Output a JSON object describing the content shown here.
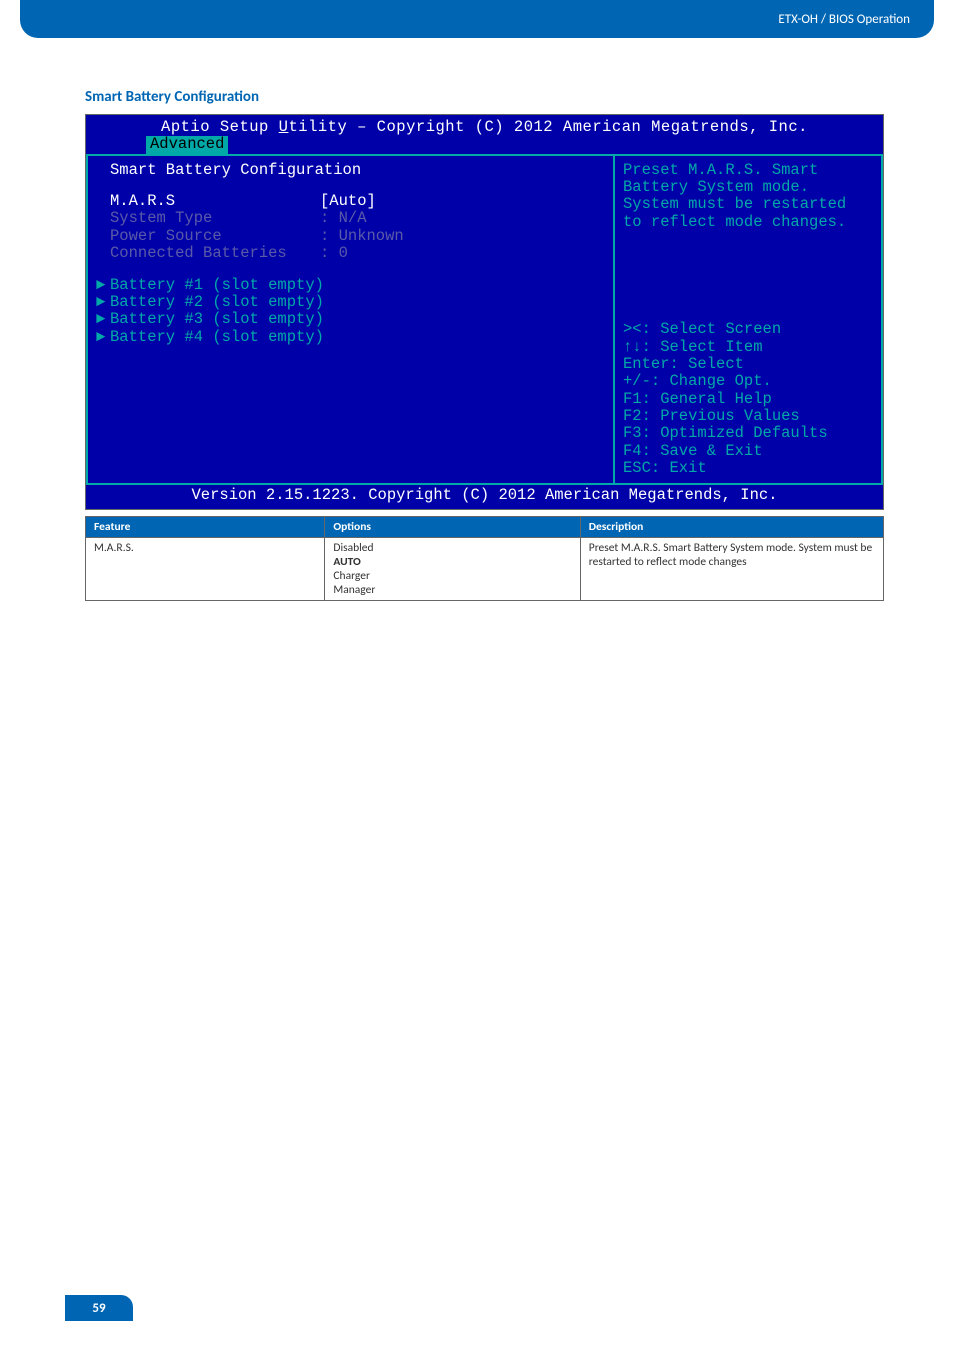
{
  "header": {
    "breadcrumb": "ETX-OH / BIOS Operation"
  },
  "section": {
    "title": "Smart Battery Configuration"
  },
  "bios": {
    "title_prefix": "Aptio Setup ",
    "title_underlined": "U",
    "title_rest": "tility – Copyright (C) 2012 American Megatrends, Inc.",
    "tab": " Advanced ",
    "heading": "Smart Battery Configuration",
    "items": [
      {
        "label": "M.A.R.S",
        "value": "[Auto]",
        "selected": true
      },
      {
        "label": "System Type",
        "value": ": N/A",
        "selected": false
      },
      {
        "label": "Power Source",
        "value": ": Unknown",
        "selected": false
      },
      {
        "label": "Connected Batteries",
        "value": ": 0",
        "selected": false
      }
    ],
    "submenus": [
      "Battery #1 (slot empty)",
      "Battery #2 (slot empty)",
      "Battery #3 (slot empty)",
      "Battery #4 (slot empty)"
    ],
    "help_text": "Preset M.A.R.S. Smart Battery System mode. System must be restarted to reflect mode changes.",
    "nav": [
      "><: Select Screen",
      "↑↓: Select Item",
      "Enter: Select",
      "+/-: Change Opt.",
      "F1: General Help",
      "F2: Previous Values",
      "F3: Optimized Defaults",
      "F4: Save & Exit",
      "ESC: Exit"
    ],
    "footer": "Version 2.15.1223. Copyright (C) 2012 American Megatrends, Inc."
  },
  "table": {
    "headers": {
      "feature": "Feature",
      "options": "Options",
      "description": "Description"
    },
    "row": {
      "feature": "M.A.R.S.",
      "options": [
        "Disabled",
        "AUTO",
        "Charger",
        "Manager"
      ],
      "default_index": 1,
      "description": "Preset M.A.R.S. Smart Battery System mode. System must be restarted to reflect mode changes"
    }
  },
  "page_number": "59",
  "chart_data": {
    "type": "table",
    "title": "Smart Battery Configuration – M.A.R.S. options",
    "columns": [
      "Feature",
      "Options",
      "Description"
    ],
    "rows": [
      [
        "M.A.R.S.",
        "Disabled | AUTO (default) | Charger | Manager",
        "Preset M.A.R.S. Smart Battery System mode. System must be restarted to reflect mode changes"
      ]
    ]
  }
}
